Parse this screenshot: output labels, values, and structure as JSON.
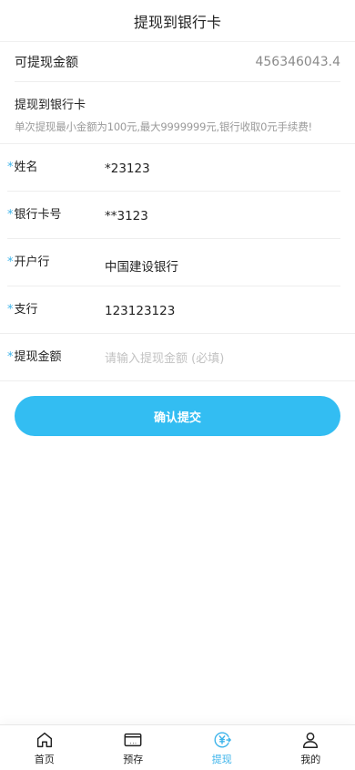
{
  "header": {
    "title": "提现到银行卡"
  },
  "balance": {
    "label": "可提现金额",
    "value": "456346043.4"
  },
  "section": {
    "title": "提现到银行卡",
    "hint": "单次提现最小金额为100元,最大9999999元,银行收取0元手续费!"
  },
  "form": {
    "required_mark": "*",
    "name": {
      "label": "姓名",
      "value": "*23123"
    },
    "card_no": {
      "label": "银行卡号",
      "value": "**3123"
    },
    "bank": {
      "label": "开户行",
      "value": "中国建设银行"
    },
    "branch": {
      "label": "支行",
      "value": "123123123"
    },
    "amount": {
      "label": "提现金额",
      "placeholder": "请输入提现金额 (必填)",
      "value": ""
    }
  },
  "submit_label": "确认提交",
  "tabbar": {
    "active_color": "#3bb3ea",
    "items": [
      {
        "label": "首页",
        "icon": "home-icon"
      },
      {
        "label": "预存",
        "icon": "wallet-icon"
      },
      {
        "label": "提现",
        "icon": "withdraw-icon"
      },
      {
        "label": "我的",
        "icon": "user-icon"
      }
    ]
  },
  "colors": {
    "accent": "#33bdf2",
    "hint": "#9a9a9a",
    "divider": "#eeeeee"
  }
}
